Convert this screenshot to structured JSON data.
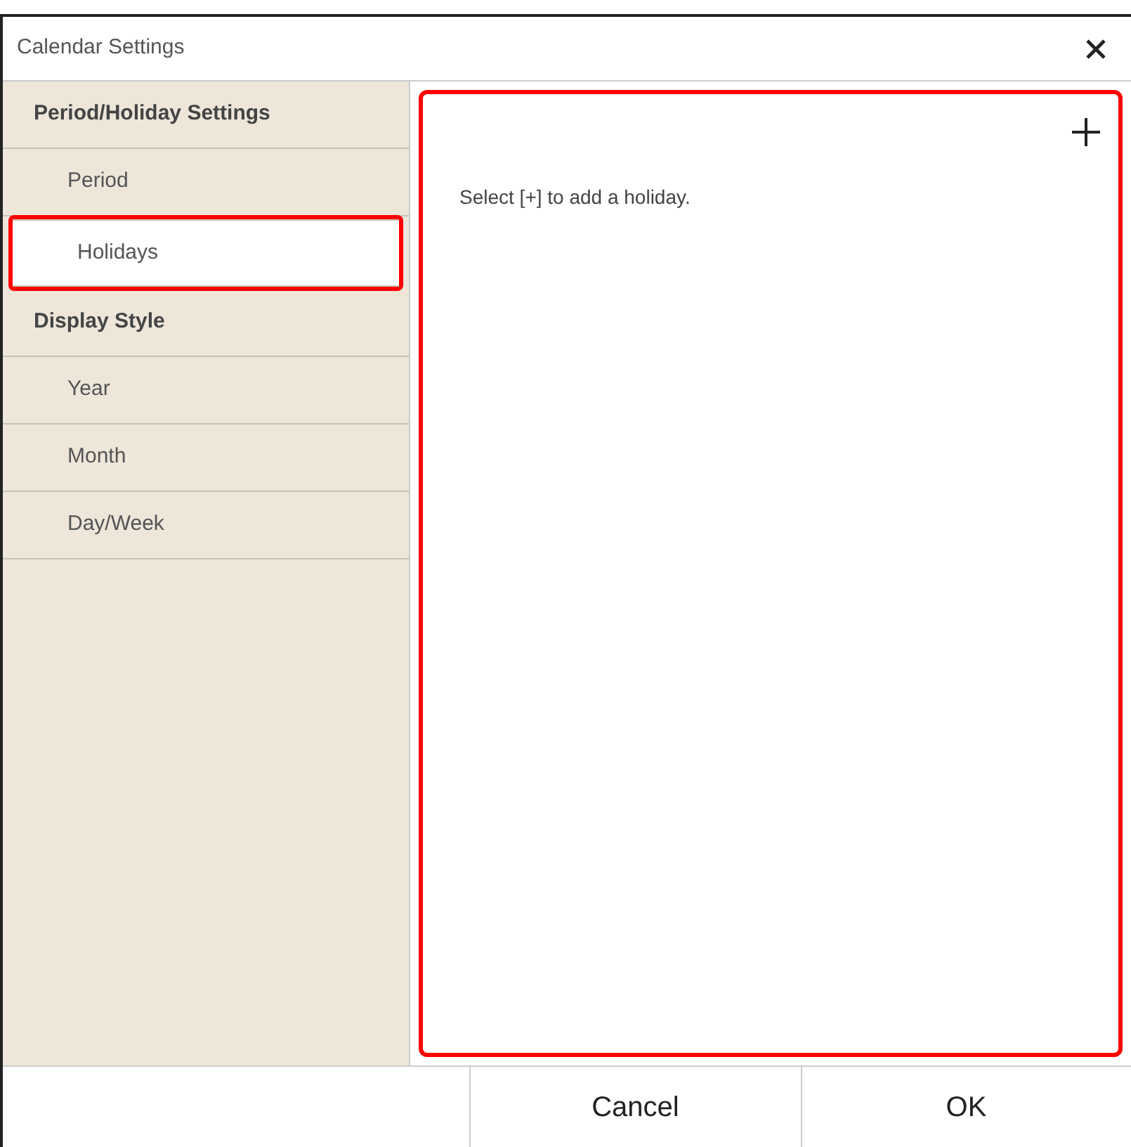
{
  "window": {
    "title": "Calendar Settings"
  },
  "sidebar": {
    "items": [
      {
        "kind": "section",
        "label": "Period/Holiday Settings",
        "selected": false,
        "highlighted": false
      },
      {
        "kind": "item",
        "label": "Period",
        "selected": false,
        "highlighted": false
      },
      {
        "kind": "item",
        "label": "Holidays",
        "selected": true,
        "highlighted": true
      },
      {
        "kind": "section",
        "label": "Display Style",
        "selected": false,
        "highlighted": false
      },
      {
        "kind": "item",
        "label": "Year",
        "selected": false,
        "highlighted": false
      },
      {
        "kind": "item",
        "label": "Month",
        "selected": false,
        "highlighted": false
      },
      {
        "kind": "item",
        "label": "Day/Week",
        "selected": false,
        "highlighted": false
      }
    ]
  },
  "content": {
    "hint": "Select [+] to add a holiday.",
    "highlighted": true
  },
  "buttons": [
    {
      "label": "Cancel"
    },
    {
      "label": "OK"
    }
  ]
}
